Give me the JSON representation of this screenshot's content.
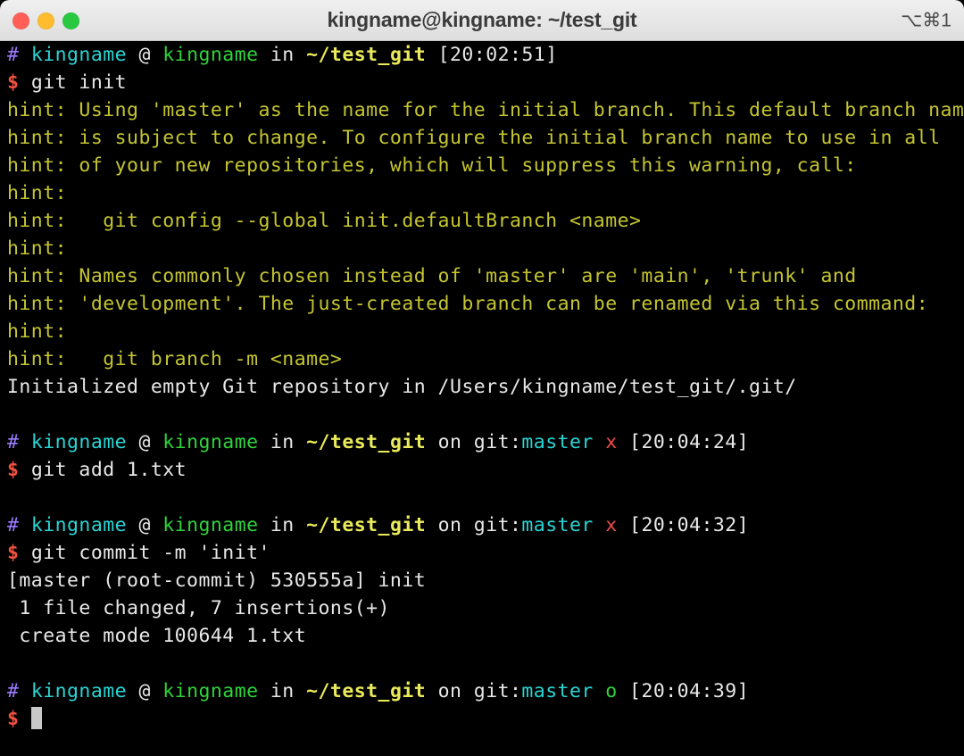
{
  "window": {
    "title": "kingname@kingname: ~/test_git",
    "shortcut": "⌥⌘1",
    "traffic_lights": {
      "close_label": "close",
      "minimize_label": "minimize",
      "zoom_label": "zoom",
      "close_color": "#ff5f57",
      "minimize_color": "#febc2e",
      "zoom_color": "#28c840"
    }
  },
  "theme": {
    "background": "#000000",
    "foreground": "#e8e8e8",
    "purple": "#9b7bff",
    "cyan": "#2ad4d4",
    "green": "#2fd43a",
    "yellow_bold": "#eaea5a",
    "hint_yellow": "#c5c531",
    "red": "#f04a4a",
    "dollar_red": "#f0523f",
    "cursor": "#c8c8c8"
  },
  "terminal": {
    "prompt_marker": "#",
    "prompt_sigil": "$",
    "user": "kingname",
    "at": "@",
    "host": "kingname",
    "in_word": "in",
    "path": "~/test_git",
    "on_word": "on",
    "git_label": "git:",
    "branch": "master",
    "dirty_flag": "x",
    "clean_flag": "o",
    "blocks": [
      {
        "type": "prompt",
        "time": "[20:02:51]",
        "git": false,
        "command": "git init"
      },
      {
        "type": "output",
        "lines": [
          {
            "text": "hint: Using 'master' as the name for the initial branch. This default branch name",
            "color": "hint"
          },
          {
            "text": "hint: is subject to change. To configure the initial branch name to use in all",
            "color": "hint"
          },
          {
            "text": "hint: of your new repositories, which will suppress this warning, call:",
            "color": "hint"
          },
          {
            "text": "hint:",
            "color": "hint"
          },
          {
            "text": "hint:   git config --global init.defaultBranch <name>",
            "color": "hint"
          },
          {
            "text": "hint:",
            "color": "hint"
          },
          {
            "text": "hint: Names commonly chosen instead of 'master' are 'main', 'trunk' and",
            "color": "hint"
          },
          {
            "text": "hint: 'development'. The just-created branch can be renamed via this command:",
            "color": "hint"
          },
          {
            "text": "hint:",
            "color": "hint"
          },
          {
            "text": "hint:   git branch -m <name>",
            "color": "hint"
          },
          {
            "text": "Initialized empty Git repository in /Users/kingname/test_git/.git/",
            "color": "white"
          },
          {
            "text": "",
            "color": "white"
          }
        ]
      },
      {
        "type": "prompt",
        "time": "[20:04:24]",
        "git": true,
        "flag": "x",
        "command": "git add 1.txt"
      },
      {
        "type": "output",
        "lines": [
          {
            "text": "",
            "color": "white"
          }
        ]
      },
      {
        "type": "prompt",
        "time": "[20:04:32]",
        "git": true,
        "flag": "x",
        "command": "git commit -m 'init'"
      },
      {
        "type": "output",
        "lines": [
          {
            "text": "[master (root-commit) 530555a] init",
            "color": "white"
          },
          {
            "text": " 1 file changed, 7 insertions(+)",
            "color": "white"
          },
          {
            "text": " create mode 100644 1.txt",
            "color": "white"
          },
          {
            "text": "",
            "color": "white"
          }
        ]
      },
      {
        "type": "prompt",
        "time": "[20:04:39]",
        "git": true,
        "flag": "o",
        "command": ""
      }
    ]
  }
}
